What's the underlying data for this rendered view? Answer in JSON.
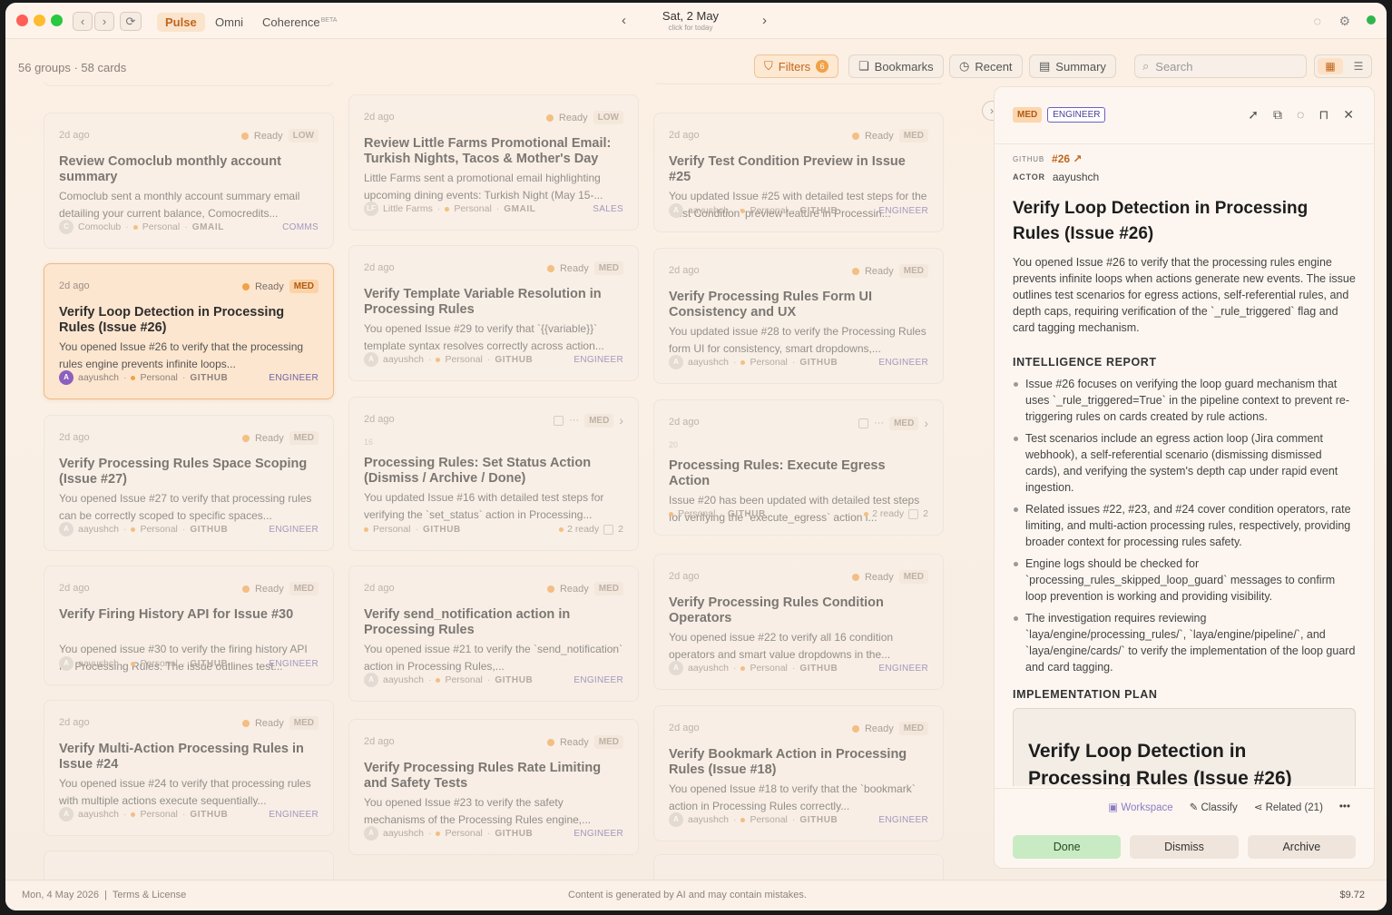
{
  "topbar": {
    "nav": [
      "Pulse",
      "Omni",
      "Coherence"
    ],
    "coherence_sup": "BETA",
    "date": "Sat, 2 May",
    "date_hint": "click for today"
  },
  "toolbar": {
    "groups": "56 groups",
    "cards_count": "58 cards",
    "filters": "Filters",
    "filters_count": "6",
    "bookmarks": "Bookmarks",
    "recent": "Recent",
    "summary": "Summary",
    "search_placeholder": "Search"
  },
  "cards": [
    {
      "ago": "2d ago",
      "status": "Ready",
      "pri": "LOW",
      "title": "Review Comoclub monthly account summary",
      "desc": "Comoclub sent a monthly account summary email detailing your current balance, Comocredits...",
      "avatar": "C",
      "name": "Comoclub",
      "space": "Personal",
      "source": "GMAIL",
      "tag": "COMMS"
    },
    {
      "ago": "2d ago",
      "status": "Ready",
      "pri": "MED",
      "title": "Verify Loop Detection in Processing Rules (Issue #26)",
      "desc": "You opened Issue #26 to verify that the processing rules engine prevents infinite loops...",
      "avatar": "A",
      "name": "aayushch",
      "space": "Personal",
      "source": "GITHUB",
      "tag": "ENGINEER"
    },
    {
      "ago": "2d ago",
      "status": "Ready",
      "pri": "MED",
      "title": "Verify Processing Rules Space Scoping (Issue #27)",
      "desc": "You opened Issue #27 to verify that processing rules can be correctly scoped to specific spaces...",
      "avatar": "A",
      "name": "aayushch",
      "space": "Personal",
      "source": "GITHUB",
      "tag": "ENGINEER"
    },
    {
      "ago": "2d ago",
      "status": "Ready",
      "pri": "MED",
      "title": "Verify Firing History API for Issue #30",
      "desc": "You opened issue #30 to verify the firing history API for Processing Rules. The issue outlines test...",
      "avatar": "A",
      "name": "aayushch",
      "space": "Personal",
      "source": "GITHUB",
      "tag": "ENGINEER"
    },
    {
      "ago": "2d ago",
      "status": "Ready",
      "pri": "MED",
      "title": "Verify Multi-Action Processing Rules in Issue #24",
      "desc": "You opened issue #24 to verify that processing rules with multiple actions execute sequentially...",
      "avatar": "A",
      "name": "aayushch",
      "space": "Personal",
      "source": "GITHUB",
      "tag": "ENGINEER"
    },
    {
      "ago": "2d ago",
      "status": "Ready",
      "pri": "LOW",
      "title": "Review Little Farms Promotional Email: Turkish Nights, Tacos & Mother's Day",
      "desc": "Little Farms sent a promotional email highlighting upcoming dining events: Turkish Night (May 15-...",
      "avatar": "LF",
      "name": "Little Farms",
      "space": "Personal",
      "source": "GMAIL",
      "tag": "SALES"
    },
    {
      "ago": "2d ago",
      "status": "Ready",
      "pri": "MED",
      "title": "Verify Template Variable Resolution in Processing Rules",
      "desc": "You opened Issue #29 to verify that `{{variable}}` template syntax resolves correctly across action...",
      "avatar": "A",
      "name": "aayushch",
      "space": "Personal",
      "source": "GITHUB",
      "tag": "ENGINEER"
    },
    {
      "ago": "2d ago",
      "status": "",
      "pri": "MED",
      "title": "Processing Rules: Set Status Action (Dismiss / Archive / Done)",
      "desc": "You updated Issue #16 with detailed test steps for verifying the `set_status` action in Processing...",
      "avatar": "",
      "name": "",
      "space": "Personal",
      "source": "GITHUB",
      "tag": "",
      "group": "16",
      "ready": "2 ready",
      "gcount": "2"
    },
    {
      "ago": "2d ago",
      "status": "Ready",
      "pri": "MED",
      "title": "Verify send_notification action in Processing Rules",
      "desc": "You opened issue #21 to verify the `send_notification` action in Processing Rules,...",
      "avatar": "A",
      "name": "aayushch",
      "space": "Personal",
      "source": "GITHUB",
      "tag": "ENGINEER"
    },
    {
      "ago": "2d ago",
      "status": "Ready",
      "pri": "MED",
      "title": "Verify Processing Rules Rate Limiting and Safety Tests",
      "desc": "You opened Issue #23 to verify the safety mechanisms of the Processing Rules engine,...",
      "avatar": "A",
      "name": "aayushch",
      "space": "Personal",
      "source": "GITHUB",
      "tag": "ENGINEER"
    },
    {
      "ago": "2d ago",
      "status": "Ready",
      "pri": "MED",
      "title": "Verify Test Condition Preview in Issue #25",
      "desc": "You updated Issue #25 with detailed test steps for the 'Test Condition' preview feature in Processin...",
      "avatar": "A",
      "name": "aayushch",
      "space": "Personal",
      "source": "GITHUB",
      "tag": "ENGINEER"
    },
    {
      "ago": "2d ago",
      "status": "Ready",
      "pri": "MED",
      "title": "Verify Processing Rules Form UI Consistency and UX",
      "desc": "You updated issue #28 to verify the Processing Rules form UI for consistency, smart dropdowns,...",
      "avatar": "A",
      "name": "aayushch",
      "space": "Personal",
      "source": "GITHUB",
      "tag": "ENGINEER"
    },
    {
      "ago": "2d ago",
      "status": "",
      "pri": "MED",
      "title": "Processing Rules: Execute Egress Action",
      "desc": "Issue #20 has been updated with detailed test steps for verifying the `execute_egress` action i...",
      "avatar": "",
      "name": "",
      "space": "Personal",
      "source": "GITHUB",
      "tag": "",
      "group": "20",
      "ready": "2 ready",
      "gcount": "2"
    },
    {
      "ago": "2d ago",
      "status": "Ready",
      "pri": "MED",
      "title": "Verify Processing Rules Condition Operators",
      "desc": "You opened issue #22 to verify all 16 condition operators and smart value dropdowns in the...",
      "avatar": "A",
      "name": "aayushch",
      "space": "Personal",
      "source": "GITHUB",
      "tag": "ENGINEER"
    },
    {
      "ago": "2d ago",
      "status": "Ready",
      "pri": "MED",
      "title": "Verify Bookmark Action in Processing Rules (Issue #18)",
      "desc": "You opened Issue #18 to verify that the `bookmark` action in Processing Rules correctly...",
      "avatar": "A",
      "name": "aayushch",
      "space": "Personal",
      "source": "GITHUB",
      "tag": "ENGINEER"
    }
  ],
  "panel": {
    "pri": "MED",
    "tag": "ENGINEER",
    "source_label": "GITHUB",
    "source_value": "#26",
    "actor_label": "ACTOR",
    "actor": "aayushch",
    "title": "Verify Loop Detection in Processing Rules (Issue #26)",
    "desc": "You opened Issue #26 to verify that the processing rules engine prevents infinite loops when actions generate new events. The issue outlines test scenarios for egress actions, self-referential rules, and depth caps, requiring verification of the `_rule_triggered` flag and card tagging mechanism.",
    "intel_heading": "INTELLIGENCE REPORT",
    "intel": [
      "Issue #26 focuses on verifying the loop guard mechanism that uses `_rule_triggered=True` in the pipeline context to prevent re-triggering rules on cards created by rule actions.",
      "Test scenarios include an egress action loop (Jira comment webhook), a self-referential scenario (dismissing dismissed cards), and verifying the system's depth cap under rapid event ingestion.",
      "Related issues #22, #23, and #24 cover condition operators, rate limiting, and multi-action processing rules, respectively, providing broader context for processing rules safety.",
      "Engine logs should be checked for `processing_rules_skipped_loop_guard` messages to confirm loop prevention is working and providing visibility.",
      "The investigation requires reviewing `laya/engine/processing_rules/`, `laya/engine/pipeline/`, and `laya/engine/cards/` to verify the implementation of the loop guard and card tagging."
    ],
    "plan_heading": "IMPLEMENTATION PLAN",
    "plan_title": "Verify Loop Detection in Processing Rules (Issue #26)",
    "workspace": "Workspace",
    "classify": "Classify",
    "related": "Related (21)",
    "done": "Done",
    "dismiss": "Dismiss",
    "archive": "Archive"
  },
  "footer": {
    "date": "Mon, 4 May 2026",
    "terms": "Terms & License",
    "disclaimer": "Content is generated by AI and may contain mistakes.",
    "cost": "$9.72"
  },
  "colors": {
    "accent": "#c0661c",
    "done": "#c8ebc4",
    "status_ok": "#2fb54f"
  }
}
